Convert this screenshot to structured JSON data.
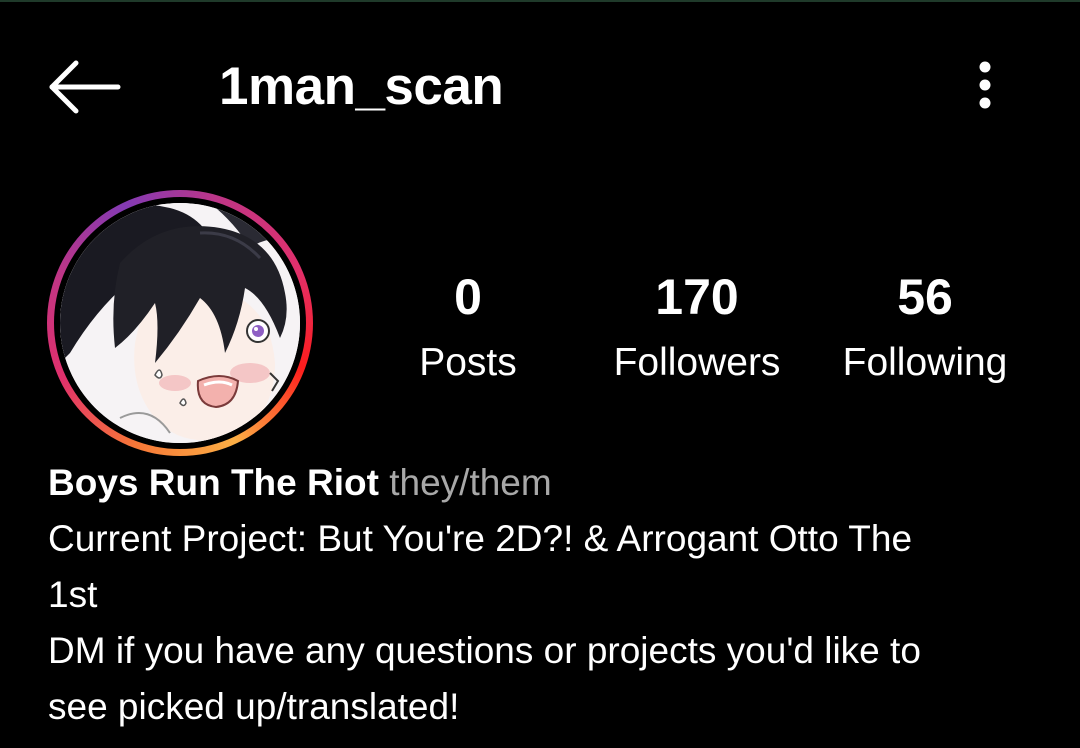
{
  "header": {
    "back_icon": "arrow-left-icon",
    "username": "1man_scan",
    "more_icon": "more-vertical-icon"
  },
  "profile": {
    "avatar_description": "anime-boy-avatar",
    "story_ring_colors": [
      "#f77737",
      "#e1306c",
      "#c13584",
      "#833ab4",
      "#fcaf45"
    ]
  },
  "stats": [
    {
      "value": "0",
      "label": "Posts"
    },
    {
      "value": "170",
      "label": "Followers"
    },
    {
      "value": "56",
      "label": "Following"
    }
  ],
  "bio": {
    "name": "Boys Run The Riot",
    "pronouns": "they/them",
    "line1": "Current Project: But You're 2D?! & Arrogant Otto The",
    "line2": "1st",
    "line3": "DM if you have any questions or projects you'd like to",
    "line4": "see picked up/translated!"
  },
  "colors": {
    "background": "#000000",
    "text": "#ffffff",
    "secondary_text": "#a8a8a8"
  }
}
